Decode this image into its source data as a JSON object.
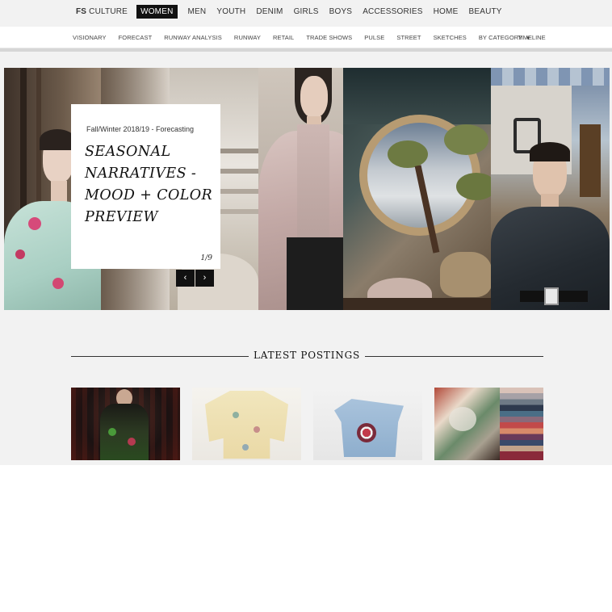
{
  "top_nav": {
    "brand_bold": "FS",
    "brand_rest": " CULTURE",
    "items": [
      "WOMEN",
      "MEN",
      "YOUTH",
      "DENIM",
      "GIRLS",
      "BOYS",
      "ACCESSORIES",
      "HOME",
      "BEAUTY"
    ],
    "active": "WOMEN"
  },
  "sub_nav": {
    "items": [
      "VISIONARY",
      "FORECAST",
      "RUNWAY ANALYSIS",
      "RUNWAY",
      "RETAIL",
      "TRADE SHOWS",
      "PULSE",
      "STREET",
      "SKETCHES"
    ],
    "by_category": "BY CATEGORY",
    "timeline": "TIMELINE"
  },
  "hero": {
    "kicker": "Fall/Winter 2018/19 - Forecasting",
    "title": "SEASONAL NARRATIVES - MOOD + COLOR PREVIEW",
    "counter": "1/9",
    "prev_glyph": "‹",
    "next_glyph": "›"
  },
  "latest": {
    "heading": "LATEST POSTINGS"
  },
  "colors": {
    "nav_active_bg": "#111111",
    "page_bg": "#f2f2f2",
    "stripe_gray": "#d6d6d6"
  }
}
